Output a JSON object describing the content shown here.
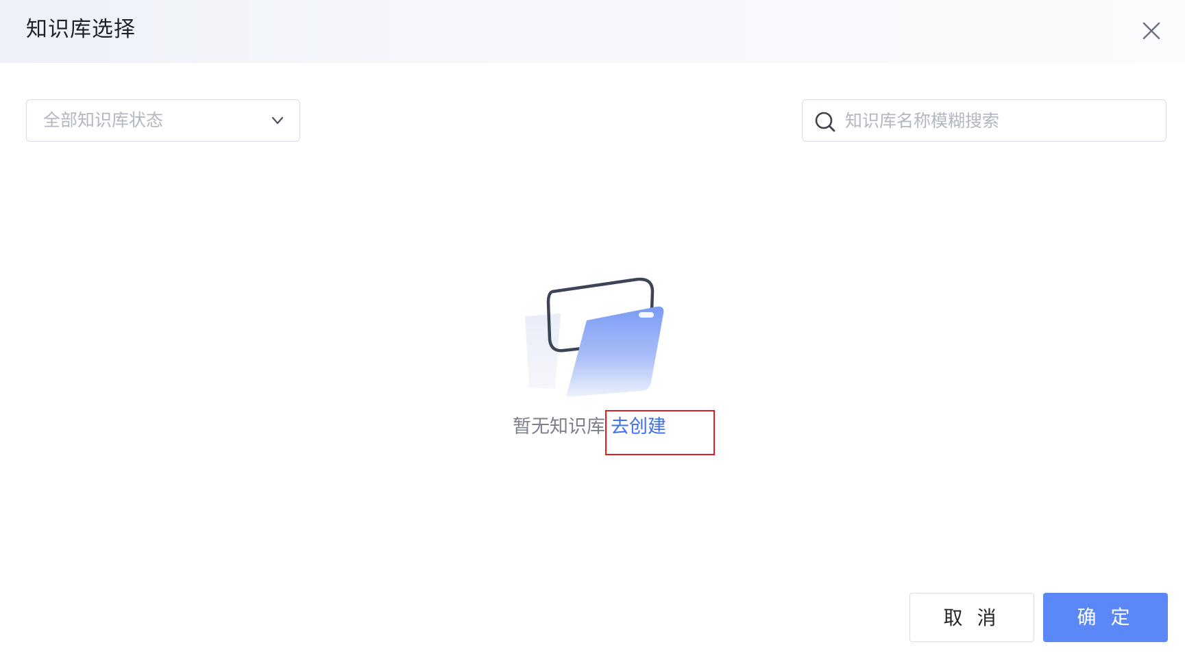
{
  "dialog": {
    "title": "知识库选择"
  },
  "filters": {
    "status_select": {
      "value": "全部知识库状态"
    },
    "search": {
      "placeholder": "知识库名称模糊搜索",
      "value": ""
    }
  },
  "empty_state": {
    "text": "暂无知识库",
    "create_link": "去创建"
  },
  "footer": {
    "cancel_label": "取 消",
    "confirm_label": "确 定"
  },
  "colors": {
    "accent": "#5b87f7",
    "link": "#3a6ff0",
    "highlight": "#e3191f"
  },
  "icons": {
    "close": "close-icon",
    "dropdown": "chevron-down-icon",
    "search": "search-icon",
    "empty": "empty-folder-illustration"
  }
}
